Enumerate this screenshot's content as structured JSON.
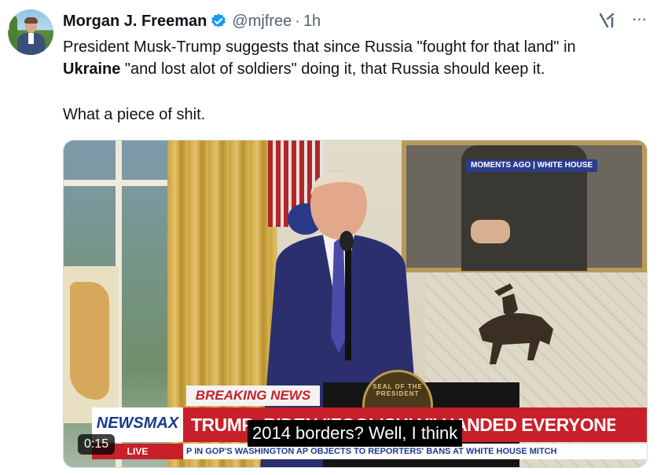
{
  "post": {
    "author_name": "Morgan J. Freeman",
    "handle": "@mjfree",
    "separator": "·",
    "time": "1h",
    "more_label": "···",
    "text_line1_a": "President Musk-Trump suggests that since Russia \"fought for that land\" in",
    "text_line2_bold": "Ukraine",
    "text_line2_rest": " \"and lost alot of soldiers\" doing it, that Russia should keep it.",
    "text_line3": "What a piece of shit."
  },
  "video": {
    "moments_banner": "MOMENTS AGO | WHITE HOUSE",
    "breaking": "BREAKING NEWS",
    "network": "NEWSMAX",
    "headline": "TRUMP: BIDEN \"FOOLISHLY\" HANDED EVERYONE MONEY",
    "live": "LIVE",
    "ticker": "P IN GOP'S WASHINGTON        AP OBJECTS TO REPORTERS' BANS AT WHITE HOUSE        MITCH",
    "caption": "2014 borders? Well, I think",
    "seal_text": "SEAL OF THE PRESIDENT",
    "duration": "0:15"
  },
  "colors": {
    "verified": "#1d9bf0",
    "newsmax_red": "#c8202a",
    "newsmax_blue": "#1b3a8c"
  },
  "icons": [
    "verified-badge-icon",
    "grok-icon",
    "more-icon"
  ]
}
